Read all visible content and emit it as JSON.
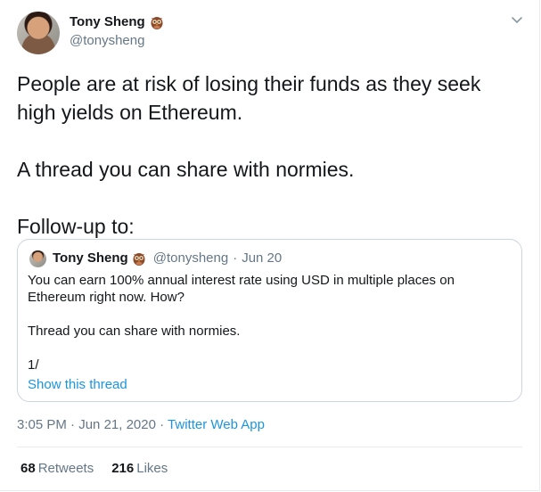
{
  "author": {
    "name": "Tony Sheng",
    "handle": "@tonysheng",
    "badge_icon": "owl-emoji-icon"
  },
  "tweet": {
    "text": "People are at risk of losing their funds as they seek high yields on Ethereum.\n\nA thread you can share with normies.\n\nFollow-up to:"
  },
  "quoted_tweet": {
    "name": "Tony Sheng",
    "handle": "@tonysheng",
    "separator": "·",
    "date": "Jun 20",
    "text": "You can earn 100% annual interest rate using USD in multiple places on Ethereum right now. How?\n\nThread you can share with normies.\n\n1/",
    "show_thread_label": "Show this thread"
  },
  "meta": {
    "time": "3:05 PM",
    "separator": "·",
    "date": "Jun 21, 2020",
    "source": "Twitter Web App"
  },
  "stats": {
    "retweets_count": "68",
    "retweets_label": "Retweets",
    "likes_count": "216",
    "likes_label": "Likes"
  },
  "colors": {
    "link": "#1b95e0",
    "secondary_text": "#657786",
    "border": "#ccd6dd"
  }
}
